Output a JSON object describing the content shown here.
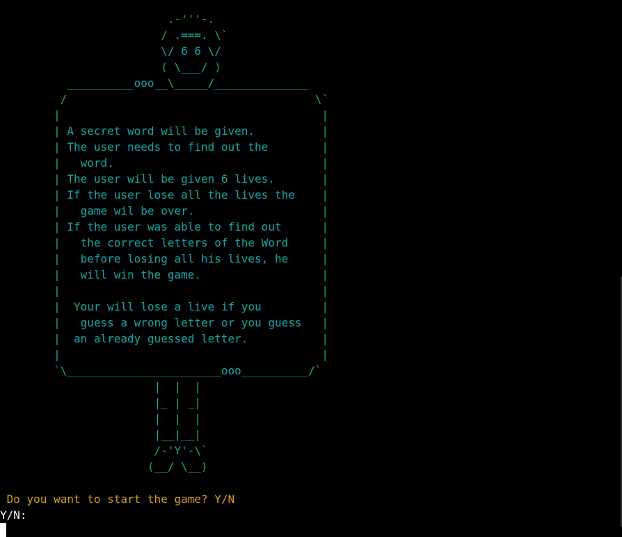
{
  "terminal": {
    "ascii_art": "                         .-'''-.\n                        / .===. \\`\n                        \\/ 6 6 \\/\n                        ( \\___/ )\n          __________ooo__\\_____/______________\n         /                                     \\`\n        |                                       |\n        | A secret word will be given.          |\n        | The user needs to find out the        |\n        |   word.                               |\n        | The user will be given 6 lives.       |\n        | If the user lose all the lives the    |\n        |   game wil be over.                   |\n        | If the user was able to find out      |\n        |   the correct letters of the Word     |\n        |   before losing all his lives, he     |\n        |   will win the game.                  |\n        |                                       |\n        |  Your will lose a live if you         |\n        |   guess a wrong letter or you guess   |\n        |  an already guessed letter.           |\n        |                                       |\n        `\\_______________________ooo__________/`\n                       |  |  |\n                       |_ | _|\n                       |  |  |\n                       |__|__|\n                       /-'Y'-\\`\n                      (__/ \\__)",
    "prompt_text": " Do you want to start the game? Y/N",
    "input_label": "Y/N:",
    "colors": {
      "background": "#000000",
      "art": "#1aa5a5",
      "prompt": "#d7a01e",
      "input": "#ffffff"
    }
  }
}
